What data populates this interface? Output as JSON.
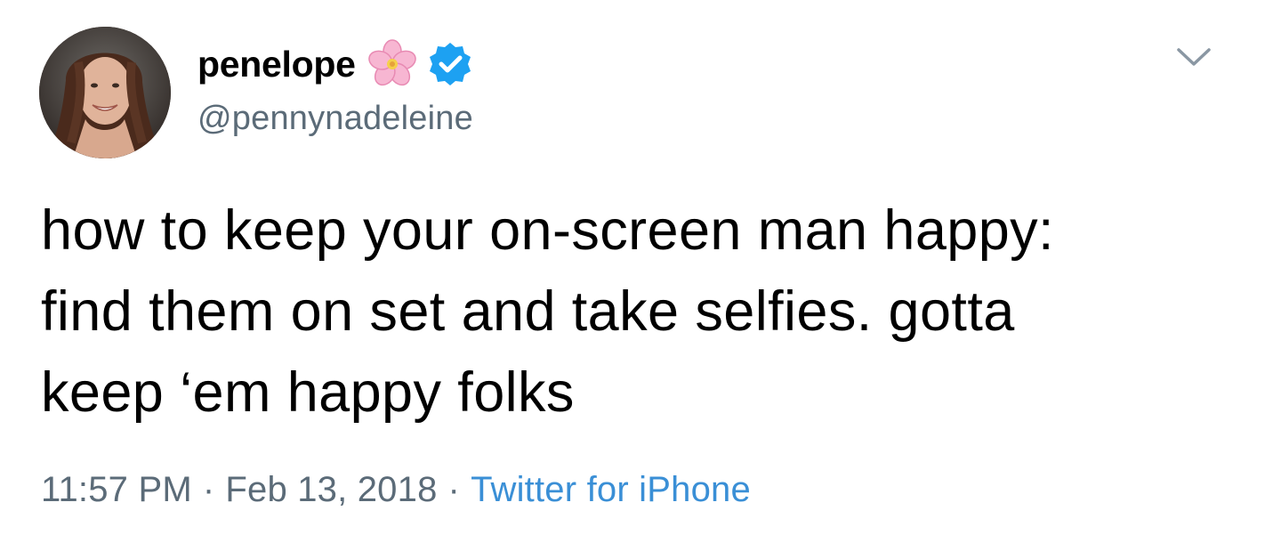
{
  "tweet": {
    "display_name": "penelope",
    "handle": "@pennynadeleine",
    "text": "how to keep your on-screen man happy:\nfind them on set and take selfies. gotta\nkeep ‘em happy folks",
    "time": "11:57 PM",
    "separator": "·",
    "date": "Feb 13, 2018",
    "source": "Twitter for iPhone"
  },
  "icons": {
    "name_emoji": "cherry-blossom-icon",
    "verified": "verified-badge-icon",
    "menu": "chevron-down-icon"
  },
  "colors": {
    "text": "#000000",
    "secondary": "#5b6b78",
    "link": "#3a8fd6",
    "verified": "#1da1f2",
    "blossom": "#f6a6c8"
  }
}
